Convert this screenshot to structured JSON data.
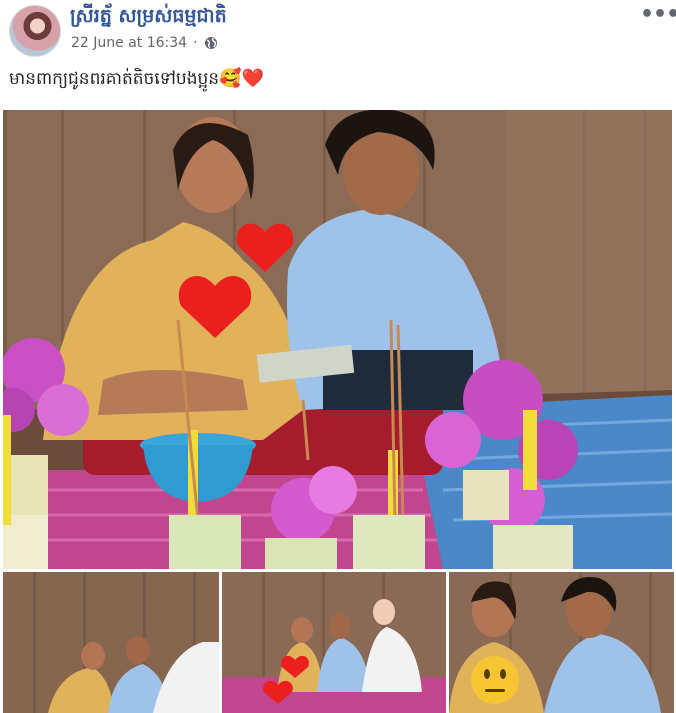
{
  "post": {
    "author_name": "ស្រីរត្ន័ សម្រស់ធម្មជាតិ",
    "timestamp": "22 June at 16:34",
    "separator": "·",
    "privacy_icon": "globe-icon",
    "more_icon": "more-options-icon",
    "more_label": "•••",
    "text": "មានពាក្យជូនពរគាត់តិចទៅបងប្អូន",
    "text_emojis": "🥰❤️"
  },
  "photos": {
    "main_icons": [
      "heart-sticker",
      "heart-sticker"
    ],
    "thumb3_icon": "neutral-face-emoji"
  }
}
